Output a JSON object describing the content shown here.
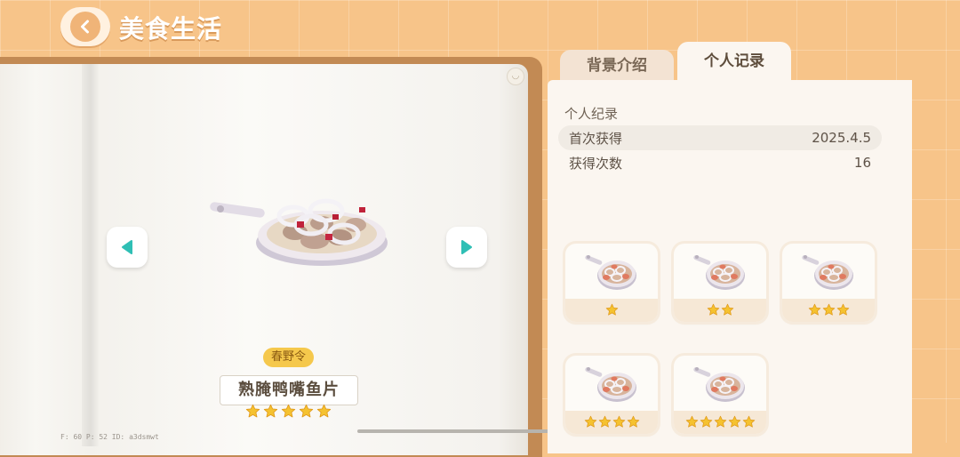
{
  "header": {
    "title": "美食生活"
  },
  "tabs": [
    {
      "label": "背景介绍",
      "active": false
    },
    {
      "label": "个人记录",
      "active": true
    }
  ],
  "dish": {
    "season_tag": "春野令",
    "name": "熟腌鸭嘴鱼片",
    "rating": 5
  },
  "record": {
    "section_title": "个人纪录",
    "first_obtained_label": "首次获得",
    "first_obtained_value": "2025.4.5",
    "count_label": "获得次数",
    "count_value": "16"
  },
  "variants": [
    {
      "stars": 1
    },
    {
      "stars": 2
    },
    {
      "stars": 3
    },
    {
      "stars": 4
    },
    {
      "stars": 5
    }
  ],
  "debug": {
    "text": "F: 60   P: 52   ID: a3dsmwt"
  },
  "colors": {
    "background": "#f7c489",
    "panel": "#fbf6f0",
    "star": "#f5c230",
    "accent_teal": "#2fbfb5",
    "tag": "#f5c84c"
  }
}
